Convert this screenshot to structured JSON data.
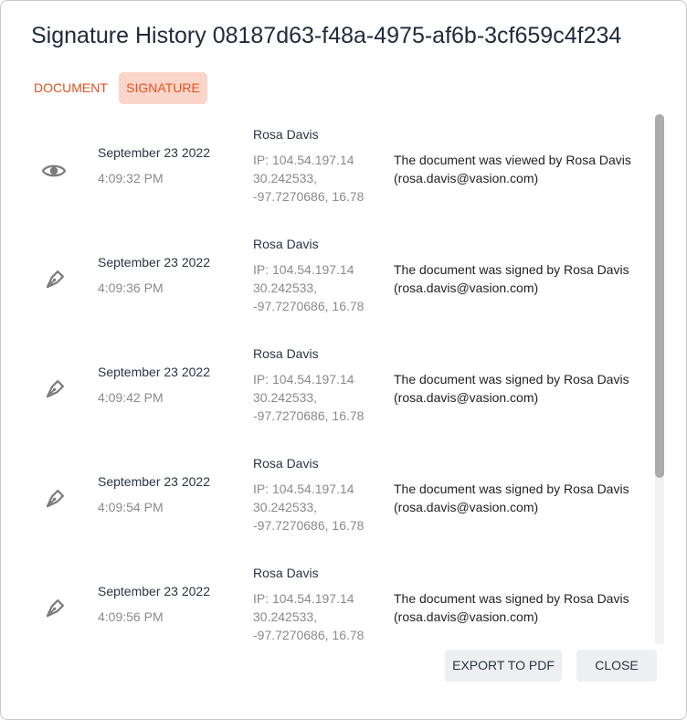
{
  "dialog": {
    "title": "Signature History 08187d63-f48a-4975-af6b-3cf659c4f234"
  },
  "tabs": [
    {
      "label": "DOCUMENT"
    },
    {
      "label": "SIGNATURE"
    }
  ],
  "entries": [
    {
      "icon": "eye-icon",
      "date": "September 23 2022",
      "time": "4:09:32 PM",
      "name": "Rosa Davis",
      "ip": "IP: 104.54.197.14",
      "location_line1": "30.242533,",
      "location_line2": "-97.7270686, 16.78",
      "desc_line1": "The document was viewed by Rosa Davis",
      "desc_line2": "(rosa.davis@vasion.com)"
    },
    {
      "icon": "pen-icon",
      "date": "September 23 2022",
      "time": "4:09:36 PM",
      "name": "Rosa Davis",
      "ip": "IP: 104.54.197.14",
      "location_line1": "30.242533,",
      "location_line2": "-97.7270686, 16.78",
      "desc_line1": "The document was signed by Rosa Davis",
      "desc_line2": "(rosa.davis@vasion.com)"
    },
    {
      "icon": "pen-icon",
      "date": "September 23 2022",
      "time": "4:09:42 PM",
      "name": "Rosa Davis",
      "ip": "IP: 104.54.197.14",
      "location_line1": "30.242533,",
      "location_line2": "-97.7270686, 16.78",
      "desc_line1": "The document was signed by Rosa Davis",
      "desc_line2": "(rosa.davis@vasion.com)"
    },
    {
      "icon": "pen-icon",
      "date": "September 23 2022",
      "time": "4:09:54 PM",
      "name": "Rosa Davis",
      "ip": "IP: 104.54.197.14",
      "location_line1": "30.242533,",
      "location_line2": "-97.7270686, 16.78",
      "desc_line1": "The document was signed by Rosa Davis",
      "desc_line2": "(rosa.davis@vasion.com)"
    },
    {
      "icon": "pen-icon",
      "date": "September 23 2022",
      "time": "4:09:56 PM",
      "name": "Rosa Davis",
      "ip": "IP: 104.54.197.14",
      "location_line1": "30.242533,",
      "location_line2": "-97.7270686, 16.78",
      "desc_line1": "The document was signed by Rosa Davis",
      "desc_line2": "(rosa.davis@vasion.com)"
    }
  ],
  "buttons": {
    "export_label": "EXPORT TO PDF",
    "close_label": "CLOSE"
  },
  "colors": {
    "accent": "#e8501c",
    "active_tab_bg": "#fbd5c9",
    "title": "#1f2a3a"
  }
}
